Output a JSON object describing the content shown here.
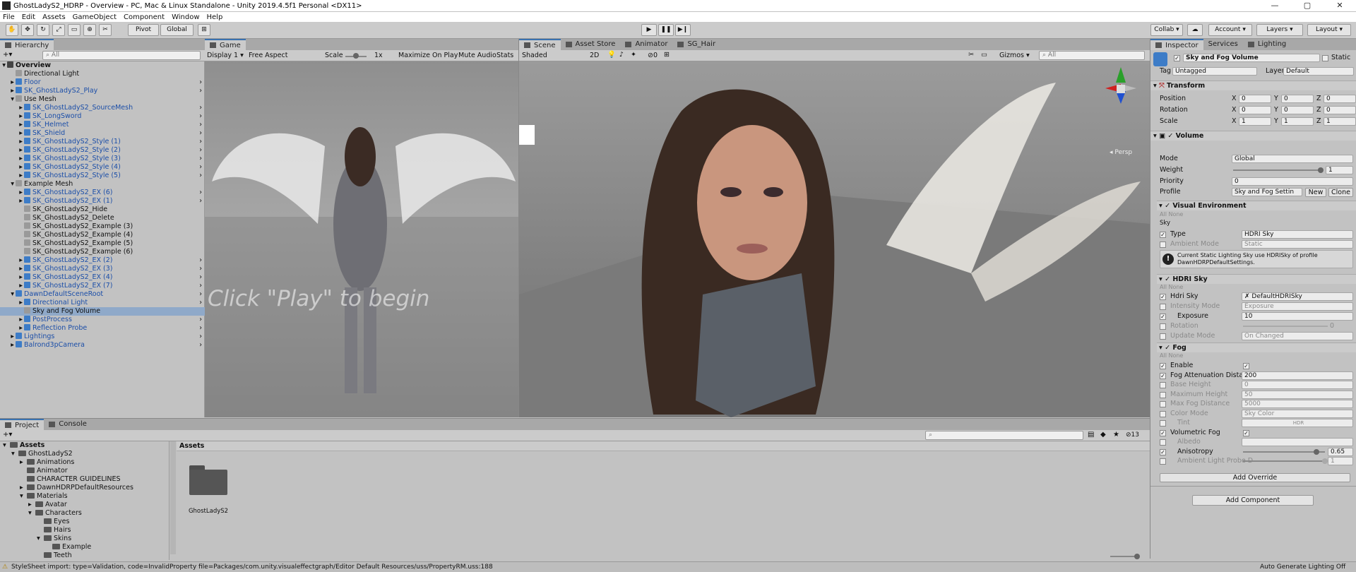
{
  "window": {
    "title": "GhostLadyS2_HDRP - Overview - PC, Mac & Linux Standalone - Unity 2019.4.5f1 Personal <DX11>",
    "controls": [
      "—",
      "▢",
      "✕"
    ]
  },
  "menu": [
    "File",
    "Edit",
    "Assets",
    "GameObject",
    "Component",
    "Window",
    "Help"
  ],
  "toolbar": {
    "pivot": "Pivot",
    "global": "Global",
    "collab": "Collab ▾",
    "account": "Account",
    "layers": "Layers",
    "layout": "Layout"
  },
  "hierarchy": {
    "tab": "Hierarchy",
    "search_placeholder": "All",
    "items": [
      {
        "label": "Overview",
        "indent": 0,
        "kind": "scene"
      },
      {
        "label": "Directional Light",
        "indent": 1,
        "kind": "plain"
      },
      {
        "label": "Floor",
        "indent": 1,
        "kind": "prefab"
      },
      {
        "label": "SK_GhostLadyS2_Play",
        "indent": 1,
        "kind": "prefab"
      },
      {
        "label": "Use Mesh",
        "indent": 1,
        "kind": "plain"
      },
      {
        "label": "SK_GhostLadyS2_SourceMesh",
        "indent": 2,
        "kind": "prefab"
      },
      {
        "label": "SK_LongSword",
        "indent": 2,
        "kind": "prefab"
      },
      {
        "label": "SK_Helmet",
        "indent": 2,
        "kind": "prefab"
      },
      {
        "label": "SK_Shield",
        "indent": 2,
        "kind": "prefab"
      },
      {
        "label": "SK_GhostLadyS2_Style (1)",
        "indent": 2,
        "kind": "prefab"
      },
      {
        "label": "SK_GhostLadyS2_Style (2)",
        "indent": 2,
        "kind": "prefab"
      },
      {
        "label": "SK_GhostLadyS2_Style (3)",
        "indent": 2,
        "kind": "prefab"
      },
      {
        "label": "SK_GhostLadyS2_Style (4)",
        "indent": 2,
        "kind": "prefab"
      },
      {
        "label": "SK_GhostLadyS2_Style (5)",
        "indent": 2,
        "kind": "prefab"
      },
      {
        "label": "Example Mesh",
        "indent": 1,
        "kind": "plain"
      },
      {
        "label": "SK_GhostLadyS2_EX (6)",
        "indent": 2,
        "kind": "prefab"
      },
      {
        "label": "SK_GhostLadyS2_EX (1)",
        "indent": 2,
        "kind": "prefab"
      },
      {
        "label": "SK_GhostLadyS2_Hide",
        "indent": 2,
        "kind": "plain"
      },
      {
        "label": "SK_GhostLadyS2_Delete",
        "indent": 2,
        "kind": "plain"
      },
      {
        "label": "SK_GhostLadyS2_Example (3)",
        "indent": 2,
        "kind": "plain"
      },
      {
        "label": "SK_GhostLadyS2_Example (4)",
        "indent": 2,
        "kind": "plain"
      },
      {
        "label": "SK_GhostLadyS2_Example (5)",
        "indent": 2,
        "kind": "plain"
      },
      {
        "label": "SK_GhostLadyS2_Example (6)",
        "indent": 2,
        "kind": "plain"
      },
      {
        "label": "SK_GhostLadyS2_EX (2)",
        "indent": 2,
        "kind": "prefab"
      },
      {
        "label": "SK_GhostLadyS2_EX (3)",
        "indent": 2,
        "kind": "prefab"
      },
      {
        "label": "SK_GhostLadyS2_EX (4)",
        "indent": 2,
        "kind": "prefab"
      },
      {
        "label": "SK_GhostLadyS2_EX (7)",
        "indent": 2,
        "kind": "prefab"
      },
      {
        "label": "DawnDefaultSceneRoot",
        "indent": 1,
        "kind": "prefab"
      },
      {
        "label": "Directional Light",
        "indent": 2,
        "kind": "prefab"
      },
      {
        "label": "Sky and Fog Volume",
        "indent": 2,
        "kind": "selected"
      },
      {
        "label": "PostProcess",
        "indent": 2,
        "kind": "prefab"
      },
      {
        "label": "Reflection Probe",
        "indent": 2,
        "kind": "prefab"
      },
      {
        "label": "Lightings",
        "indent": 1,
        "kind": "prefab"
      },
      {
        "label": "Balrond3pCamera",
        "indent": 1,
        "kind": "prefab"
      }
    ]
  },
  "game": {
    "tab": "Game",
    "display": "Display 1",
    "aspect": "Free Aspect",
    "scale_label": "Scale",
    "scale_value": "1x",
    "maximize": "Maximize On Play",
    "mute": "Mute Audio",
    "stats": "Stats",
    "overlay_text": "Click \"Play\" to begin"
  },
  "scene": {
    "tabs": [
      "Scene",
      "Asset Store",
      "Animator",
      "SG_Hair"
    ],
    "shading": "Shaded",
    "mode2d": "2D",
    "gizmos": "Gizmos",
    "search_placeholder": "All",
    "persp": "Persp",
    "fx_count": "0"
  },
  "inspector": {
    "tabs": [
      "Inspector",
      "Services",
      "Lighting"
    ],
    "object_name": "Sky and Fog Volume",
    "static_label": "Static",
    "tag_label": "Tag",
    "tag_value": "Untagged",
    "layer_label": "Layer",
    "layer_value": "Default",
    "transform": {
      "title": "Transform",
      "position_label": "Position",
      "rotation_label": "Rotation",
      "scale_label": "Scale",
      "position": [
        "0",
        "0",
        "0"
      ],
      "rotation": [
        "0",
        "0",
        "0"
      ],
      "scale": [
        "1",
        "1",
        "1"
      ],
      "axes": [
        "X",
        "Y",
        "Z"
      ]
    },
    "volume": {
      "title": "Volume",
      "mode_label": "Mode",
      "mode_value": "Global",
      "weight_label": "Weight",
      "weight_value": "1",
      "priority_label": "Priority",
      "priority_value": "0",
      "profile_label": "Profile",
      "profile_value": "Sky and Fog Settin",
      "new_btn": "New",
      "clone_btn": "Clone"
    },
    "visual_env": {
      "title": "Visual Environment",
      "all": "All",
      "none": "None",
      "sky": "Sky",
      "type_label": "Type",
      "type_value": "HDRI Sky",
      "ambient_label": "Ambient Mode",
      "ambient_value": "Static",
      "warning": "Current Static Lighting Sky use HDRISky of profile DawnHDRPDefaultSettings."
    },
    "hdri_sky": {
      "title": "HDRI Sky",
      "all": "All",
      "none": "None",
      "hdri_label": "Hdri Sky",
      "hdri_value": "DefaultHDRISky",
      "intensity_label": "Intensity Mode",
      "intensity_value": "Exposure",
      "exposure_label": "Exposure",
      "exposure_value": "10",
      "rotation_label": "Rotation",
      "rotation_value": "0",
      "update_label": "Update Mode",
      "update_value": "On Changed"
    },
    "fog": {
      "title": "Fog",
      "all": "All",
      "none": "None",
      "enable_label": "Enable",
      "atten_label": "Fog Attenuation Distanc",
      "atten_value": "200",
      "base_label": "Base Height",
      "base_value": "0",
      "max_h_label": "Maximum Height",
      "max_h_value": "50",
      "max_d_label": "Max Fog Distance",
      "max_d_value": "5000",
      "color_label": "Color Mode",
      "color_value": "Sky Color",
      "tint_label": "Tint",
      "tint_value": "HDR",
      "vol_label": "Volumetric Fog",
      "albedo_label": "Albedo",
      "aniso_label": "Anisotropy",
      "aniso_value": "0.65",
      "ambient_probe_label": "Ambient Light Probe D",
      "ambient_probe_value": "1"
    },
    "add_override": "Add Override",
    "add_component": "Add Component"
  },
  "project": {
    "tabs": [
      "Project",
      "Console"
    ],
    "favorites_count": "13",
    "breadcrumb": "Assets",
    "tree": [
      {
        "label": "Assets",
        "indent": 0,
        "bold": true
      },
      {
        "label": "GhostLadyS2",
        "indent": 1
      },
      {
        "label": "Animations",
        "indent": 2
      },
      {
        "label": "Animator",
        "indent": 2
      },
      {
        "label": "CHARACTER GUIDELINES",
        "indent": 2
      },
      {
        "label": "DawnHDRPDefaultResources",
        "indent": 2
      },
      {
        "label": "Materials",
        "indent": 2
      },
      {
        "label": "Avatar",
        "indent": 3
      },
      {
        "label": "Characters",
        "indent": 3
      },
      {
        "label": "Eyes",
        "indent": 4
      },
      {
        "label": "Hairs",
        "indent": 4
      },
      {
        "label": "Skins",
        "indent": 4
      },
      {
        "label": "Example",
        "indent": 5
      },
      {
        "label": "Teeth",
        "indent": 4
      }
    ],
    "asset_item": "GhostLadyS2"
  },
  "status": {
    "message": "StyleSheet import: type=Validation, code=InvalidProperty file=Packages/com.unity.visualeffectgraph/Editor Default Resources/uss/PropertyRM.uss:188",
    "right": "Auto Generate Lighting Off"
  },
  "colors": {
    "accent": "#3a72b0",
    "prefab_blue": "#1b4ea8",
    "panel": "#c2c2c2"
  }
}
